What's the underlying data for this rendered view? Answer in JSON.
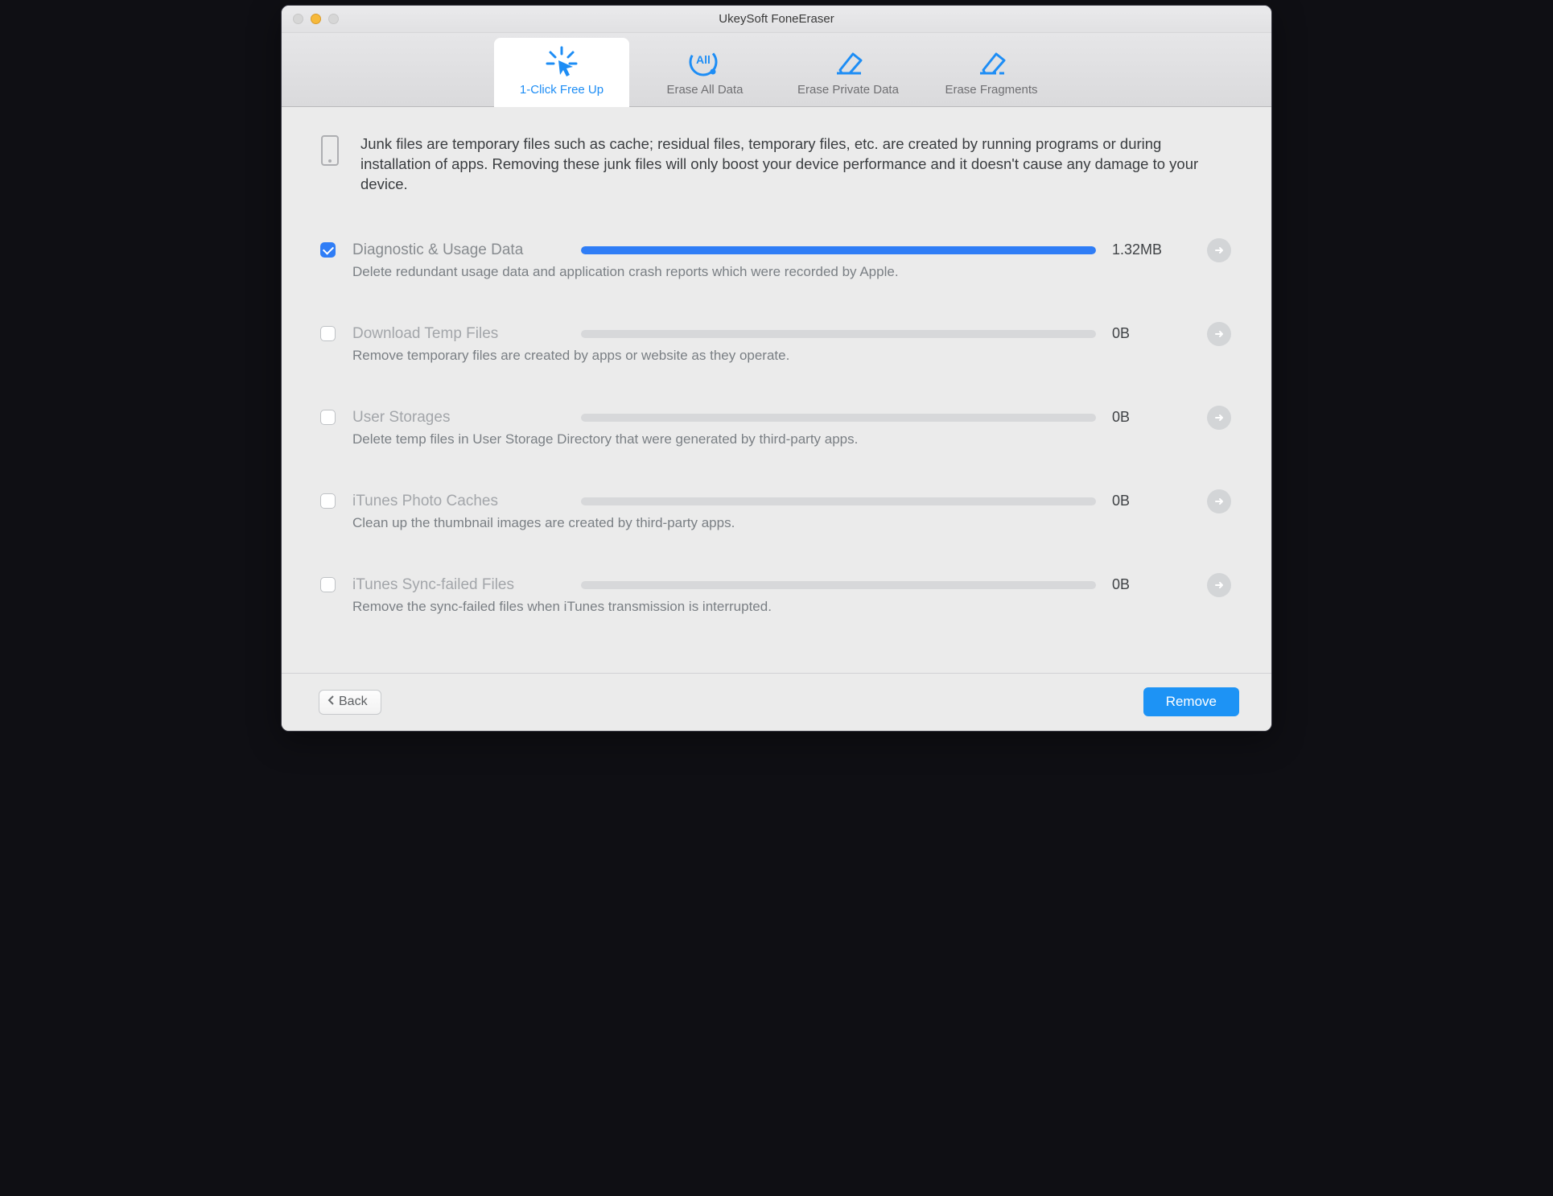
{
  "window": {
    "title": "UkeySoft FoneEraser"
  },
  "tabs": [
    {
      "label": "1-Click Free Up"
    },
    {
      "label": "Erase All Data"
    },
    {
      "label": "Erase Private Data"
    },
    {
      "label": "Erase Fragments"
    }
  ],
  "intro": {
    "text": "Junk files are temporary files such as cache; residual files, temporary files, etc. are created by running programs or during installation of apps. Removing these junk files will only boost your device performance and it doesn't cause any damage to your device."
  },
  "items": [
    {
      "title": "Diagnostic & Usage Data",
      "desc": "Delete redundant usage data and application crash reports which were recorded by Apple.",
      "size": "1.32MB",
      "checked": true,
      "fillPct": 100
    },
    {
      "title": "Download Temp Files",
      "desc": "Remove temporary files are created by apps or website as they operate.",
      "size": "0B",
      "checked": false,
      "fillPct": 0
    },
    {
      "title": "User Storages",
      "desc": "Delete temp files in User Storage Directory that were generated by third-party apps.",
      "size": "0B",
      "checked": false,
      "fillPct": 0
    },
    {
      "title": "iTunes Photo Caches",
      "desc": "Clean up the thumbnail images are created by third-party apps.",
      "size": "0B",
      "checked": false,
      "fillPct": 0
    },
    {
      "title": "iTunes Sync-failed Files",
      "desc": "Remove the sync-failed files when iTunes transmission is interrupted.",
      "size": "0B",
      "checked": false,
      "fillPct": 0
    }
  ],
  "footer": {
    "back": "Back",
    "remove": "Remove"
  }
}
